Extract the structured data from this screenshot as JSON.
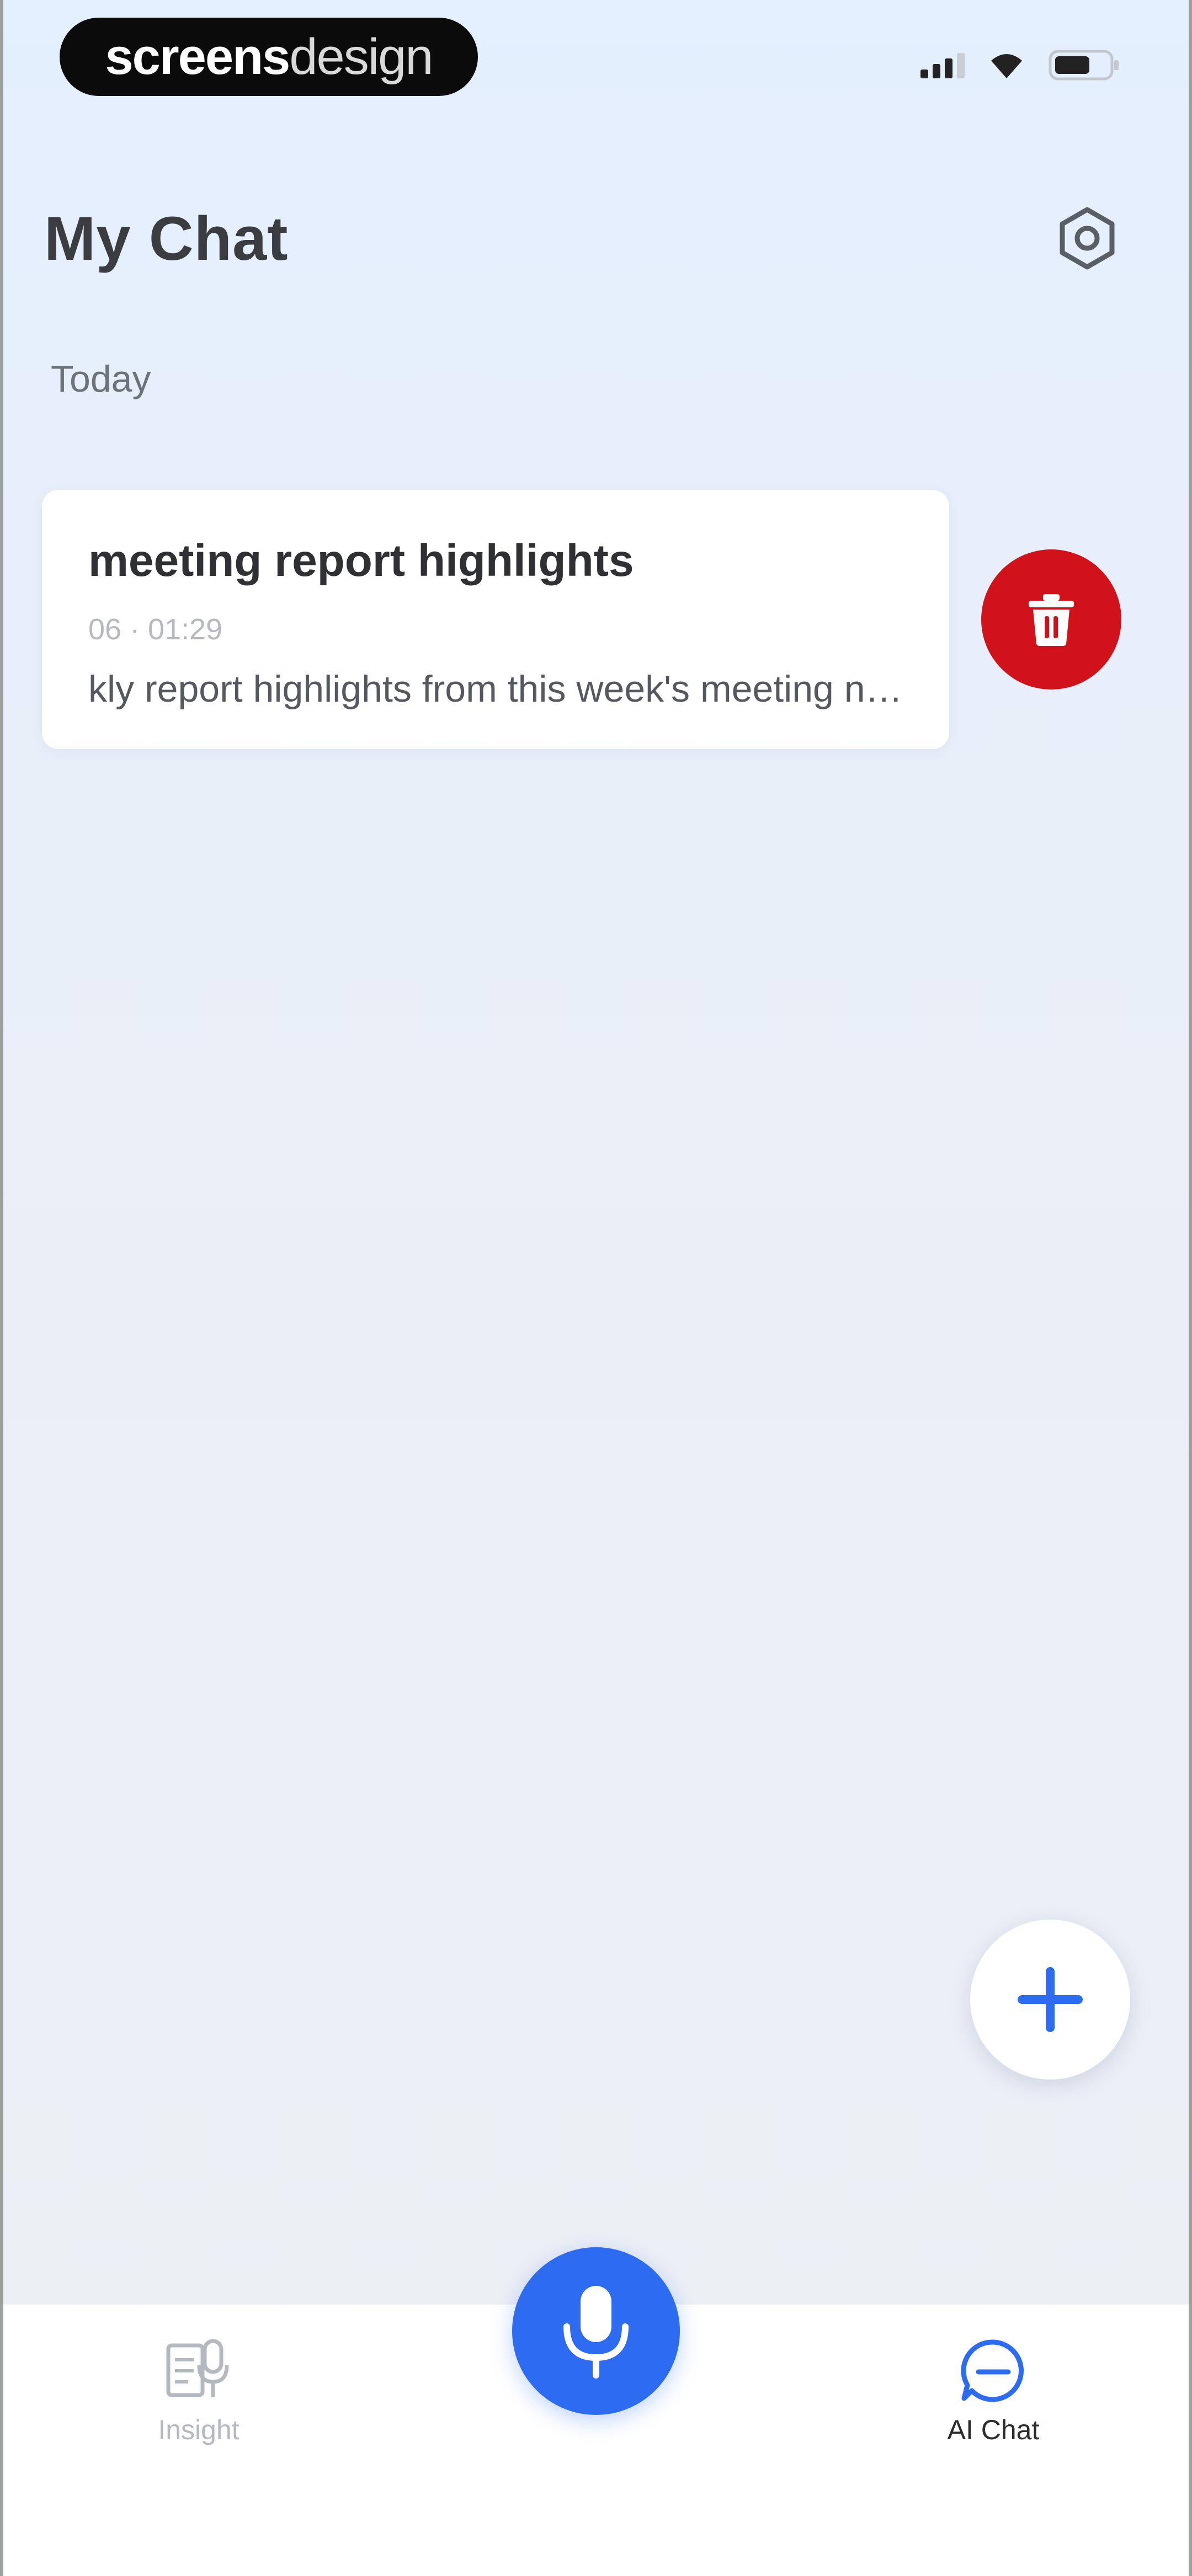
{
  "status_bar": {
    "brand_bold": "screens",
    "brand_light": "design",
    "icons": [
      "signal-icon",
      "wifi-icon",
      "battery-icon"
    ]
  },
  "header": {
    "title": "My Chat",
    "settings_icon": "gear-icon"
  },
  "section": {
    "label": "Today"
  },
  "chat_item": {
    "title": "meeting report highlights",
    "date": "06 · 01:29",
    "preview": "kly report highlights from this week's meeting not...",
    "delete_icon": "trash-icon"
  },
  "fab": {
    "icon": "plus-icon"
  },
  "bottom_nav": {
    "items": [
      {
        "label": "Insight",
        "icon": "insight-icon",
        "active": false
      },
      {
        "label": "AI Chat",
        "icon": "chat-icon",
        "active": true
      }
    ],
    "mic_icon": "microphone-icon"
  },
  "colors": {
    "accent": "#2d6cf0",
    "danger": "#d0121b",
    "background_top": "#e4efff",
    "background_bottom": "#edf0f5"
  }
}
